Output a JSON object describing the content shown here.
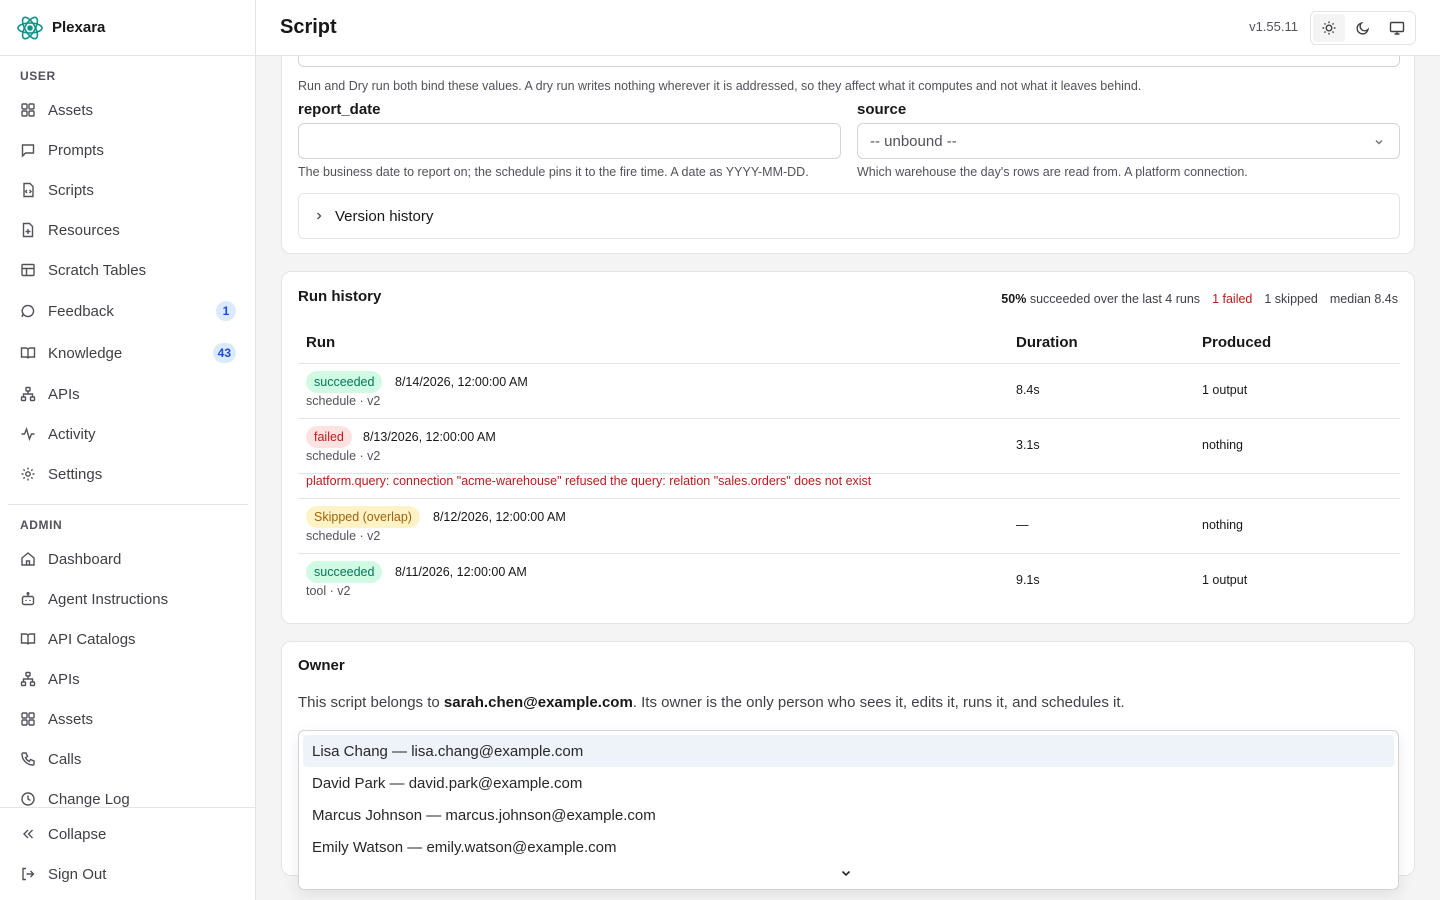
{
  "app": {
    "name": "Plexara",
    "version": "v1.55.11"
  },
  "header": {
    "title": "Script"
  },
  "sidebar": {
    "user_label": "USER",
    "user_items": [
      {
        "label": "Assets",
        "icon": "grid-icon"
      },
      {
        "label": "Prompts",
        "icon": "message-square-icon"
      },
      {
        "label": "Scripts",
        "icon": "file-code-icon"
      },
      {
        "label": "Resources",
        "icon": "file-plus-icon"
      },
      {
        "label": "Scratch Tables",
        "icon": "table-icon"
      },
      {
        "label": "Feedback",
        "icon": "message-circle-icon",
        "badge": "1"
      },
      {
        "label": "Knowledge",
        "icon": "book-open-icon",
        "badge": "43"
      },
      {
        "label": "APIs",
        "icon": "network-icon"
      },
      {
        "label": "Activity",
        "icon": "activity-icon"
      },
      {
        "label": "Settings",
        "icon": "gear-icon"
      }
    ],
    "admin_label": "ADMIN",
    "admin_items": [
      {
        "label": "Dashboard",
        "icon": "home-icon"
      },
      {
        "label": "Agent Instructions",
        "icon": "bot-icon"
      },
      {
        "label": "API Catalogs",
        "icon": "book-open-icon"
      },
      {
        "label": "APIs",
        "icon": "network-icon"
      },
      {
        "label": "Assets",
        "icon": "grid-icon"
      },
      {
        "label": "Calls",
        "icon": "phone-icon"
      },
      {
        "label": "Change Log",
        "icon": "clock-icon"
      }
    ],
    "collapse_label": "Collapse",
    "signout_label": "Sign Out"
  },
  "params": {
    "intro": "Run and Dry run both bind these values. A dry run writes nothing wherever it is addressed, so they affect what it computes and not what it leaves behind.",
    "report_date": {
      "label": "report_date",
      "value": "",
      "help": "The business date to report on; the schedule pins it to the fire time. A date as YYYY-MM-DD."
    },
    "source": {
      "label": "source",
      "value": "-- unbound --",
      "help": "Which warehouse the day's rows are read from. A platform connection."
    },
    "version_history": "Version history"
  },
  "runs": {
    "title": "Run history",
    "stats": {
      "pct": "50%",
      "pct_text": "succeeded over the last 4 runs",
      "failed": "1 failed",
      "skipped": "1 skipped",
      "median": "median 8.4s"
    },
    "columns": {
      "run": "Run",
      "duration": "Duration",
      "produced": "Produced"
    },
    "rows": [
      {
        "status": "succeeded",
        "date": "8/14/2026, 12:00:00 AM",
        "meta": "schedule · v2",
        "duration": "8.4s",
        "produced": "1 output"
      },
      {
        "status": "failed",
        "date": "8/13/2026, 12:00:00 AM",
        "meta": "schedule · v2",
        "duration": "3.1s",
        "produced": "nothing",
        "error": "platform.query: connection \"acme-warehouse\" refused the query: relation \"sales.orders\" does not exist"
      },
      {
        "status": "Skipped (overlap)",
        "date": "8/12/2026, 12:00:00 AM",
        "meta": "schedule · v2",
        "duration": "—",
        "produced": "nothing"
      },
      {
        "status": "succeeded",
        "date": "8/11/2026, 12:00:00 AM",
        "meta": "tool · v2",
        "duration": "9.1s",
        "produced": "1 output"
      }
    ]
  },
  "owner": {
    "title": "Owner",
    "prefix": "This script belongs to ",
    "email": "sarah.chen@example.com",
    "suffix": ". Its owner is the only person who sees it, edits it, runs it, and schedules it.",
    "options": [
      "Lisa Chang — lisa.chang@example.com",
      "David Park — david.park@example.com",
      "Marcus Johnson — marcus.johnson@example.com",
      "Emily Watson — emily.watson@example.com"
    ]
  }
}
